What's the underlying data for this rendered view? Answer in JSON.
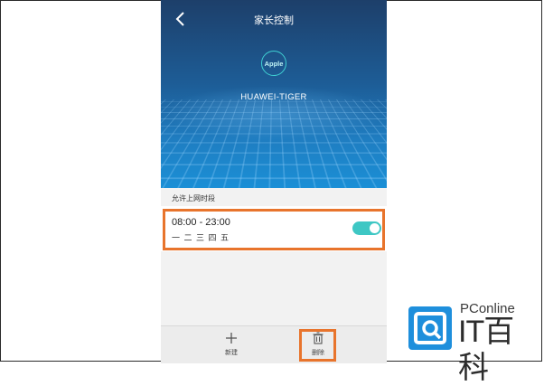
{
  "header": {
    "title": "家长控制",
    "back_icon": "chevron-left-icon"
  },
  "device": {
    "badge": "Apple",
    "name": "HUAWEI-TIGER"
  },
  "section": {
    "label": "允许上网时段"
  },
  "schedule": {
    "time": "08:00 - 23:00",
    "days": "一 二 三 四 五",
    "enabled": true,
    "toggle_color": "#3ec7c4"
  },
  "bottom_bar": {
    "new_label": "新建",
    "delete_label": "删除",
    "new_icon": "plus-icon",
    "delete_icon": "trash-icon"
  },
  "highlight_color": "#e8742c",
  "watermark": {
    "brand_small": "PConline",
    "brand_big": "IT百科",
    "brand_color": "#1e8fdc"
  }
}
